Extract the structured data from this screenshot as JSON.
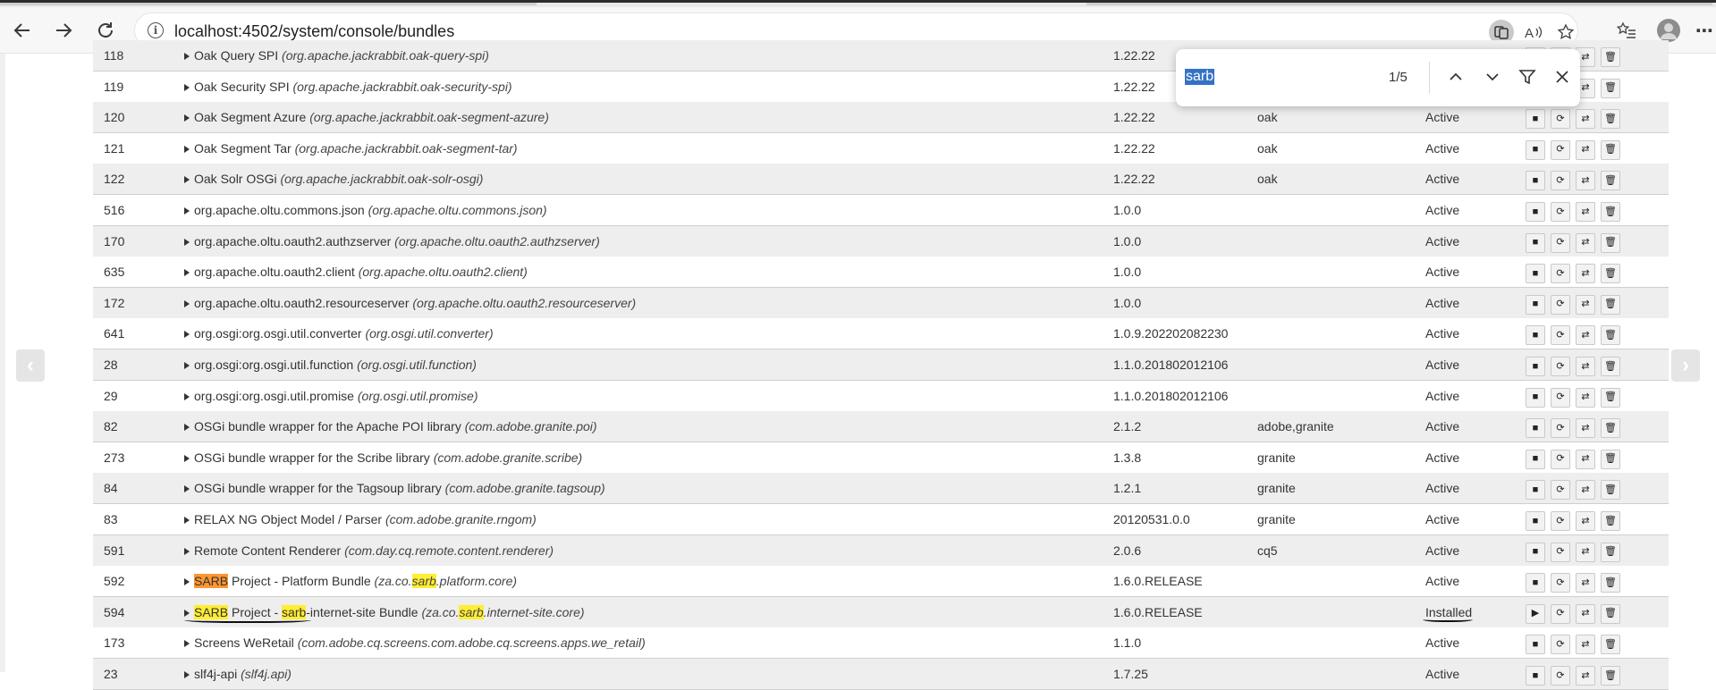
{
  "browser": {
    "url": "localhost:4502/system/console/bundles",
    "back_icon": "arrow-left-icon",
    "forward_icon": "arrow-right-icon",
    "reload_icon": "reload-icon",
    "more_label": "⋯"
  },
  "find_bar": {
    "query": "sarb",
    "match_count": "1/5"
  },
  "bundles": [
    {
      "id": "118",
      "name": "Oak Query SPI",
      "symbolic": "(org.apache.jackrabbit.oak-query-spi)",
      "version": "1.22.22",
      "category": "",
      "status": ""
    },
    {
      "id": "119",
      "name": "Oak Security SPI",
      "symbolic": "(org.apache.jackrabbit.oak-security-spi)",
      "version": "1.22.22",
      "category": "",
      "status": ""
    },
    {
      "id": "120",
      "name": "Oak Segment Azure",
      "symbolic": "(org.apache.jackrabbit.oak-segment-azure)",
      "version": "1.22.22",
      "category": "oak",
      "status": "Active"
    },
    {
      "id": "121",
      "name": "Oak Segment Tar",
      "symbolic": "(org.apache.jackrabbit.oak-segment-tar)",
      "version": "1.22.22",
      "category": "oak",
      "status": "Active"
    },
    {
      "id": "122",
      "name": "Oak Solr OSGi",
      "symbolic": "(org.apache.jackrabbit.oak-solr-osgi)",
      "version": "1.22.22",
      "category": "oak",
      "status": "Active"
    },
    {
      "id": "516",
      "name": "org.apache.oltu.commons.json",
      "symbolic": "(org.apache.oltu.commons.json)",
      "version": "1.0.0",
      "category": "",
      "status": "Active"
    },
    {
      "id": "170",
      "name": "org.apache.oltu.oauth2.authzserver",
      "symbolic": "(org.apache.oltu.oauth2.authzserver)",
      "version": "1.0.0",
      "category": "",
      "status": "Active"
    },
    {
      "id": "635",
      "name": "org.apache.oltu.oauth2.client",
      "symbolic": "(org.apache.oltu.oauth2.client)",
      "version": "1.0.0",
      "category": "",
      "status": "Active"
    },
    {
      "id": "172",
      "name": "org.apache.oltu.oauth2.resourceserver",
      "symbolic": "(org.apache.oltu.oauth2.resourceserver)",
      "version": "1.0.0",
      "category": "",
      "status": "Active"
    },
    {
      "id": "641",
      "name": "org.osgi:org.osgi.util.converter",
      "symbolic": "(org.osgi.util.converter)",
      "version": "1.0.9.202202082230",
      "category": "",
      "status": "Active"
    },
    {
      "id": "28",
      "name": "org.osgi:org.osgi.util.function",
      "symbolic": "(org.osgi.util.function)",
      "version": "1.1.0.201802012106",
      "category": "",
      "status": "Active"
    },
    {
      "id": "29",
      "name": "org.osgi:org.osgi.util.promise",
      "symbolic": "(org.osgi.util.promise)",
      "version": "1.1.0.201802012106",
      "category": "",
      "status": "Active"
    },
    {
      "id": "82",
      "name": "OSGi bundle wrapper for the Apache POI library",
      "symbolic": "(com.adobe.granite.poi)",
      "version": "2.1.2",
      "category": "adobe,granite",
      "status": "Active"
    },
    {
      "id": "273",
      "name": "OSGi bundle wrapper for the Scribe library",
      "symbolic": "(com.adobe.granite.scribe)",
      "version": "1.3.8",
      "category": "granite",
      "status": "Active"
    },
    {
      "id": "84",
      "name": "OSGi bundle wrapper for the Tagsoup library",
      "symbolic": "(com.adobe.granite.tagsoup)",
      "version": "1.2.1",
      "category": "granite",
      "status": "Active"
    },
    {
      "id": "83",
      "name": "RELAX NG Object Model / Parser",
      "symbolic": "(com.adobe.granite.rngom)",
      "version": "20120531.0.0",
      "category": "granite",
      "status": "Active"
    },
    {
      "id": "591",
      "name": "Remote Content Renderer",
      "symbolic": "(com.day.cq.remote.content.renderer)",
      "version": "2.0.6",
      "category": "cq5",
      "status": "Active"
    },
    {
      "id": "592",
      "name_parts": [
        {
          "t": "SARB",
          "h": "cur"
        },
        {
          "t": " Project - Platform Bundle "
        }
      ],
      "symbolic_parts": [
        {
          "t": "(za.co."
        },
        {
          "t": "sarb",
          "h": "hl"
        },
        {
          "t": ".platform.core)"
        }
      ],
      "version": "1.6.0.RELEASE",
      "category": "",
      "status": "Active"
    },
    {
      "id": "594",
      "name_parts": [
        {
          "t": "SARB",
          "h": "hl"
        },
        {
          "t": " Project - "
        },
        {
          "t": "sarb",
          "h": "hl"
        },
        {
          "t": "-internet-site Bundle "
        }
      ],
      "symbolic_parts": [
        {
          "t": "(za.co."
        },
        {
          "t": "sarb",
          "h": "hl"
        },
        {
          "t": ".internet-site.core)"
        }
      ],
      "version": "1.6.0.RELEASE",
      "category": "",
      "status": "Installed"
    },
    {
      "id": "173",
      "name": "Screens WeRetail",
      "symbolic": "(com.adobe.cq.screens.com.adobe.cq.screens.apps.we_retail)",
      "version": "1.1.0",
      "category": "",
      "status": "Active"
    },
    {
      "id": "23",
      "name": "slf4j-api",
      "symbolic": "(slf4j.api)",
      "version": "1.7.25",
      "category": "",
      "status": "Active"
    }
  ],
  "icons": {
    "stop": "■",
    "start": "▶",
    "refresh": "⟳",
    "update": "⇄",
    "delete": "🗑"
  }
}
